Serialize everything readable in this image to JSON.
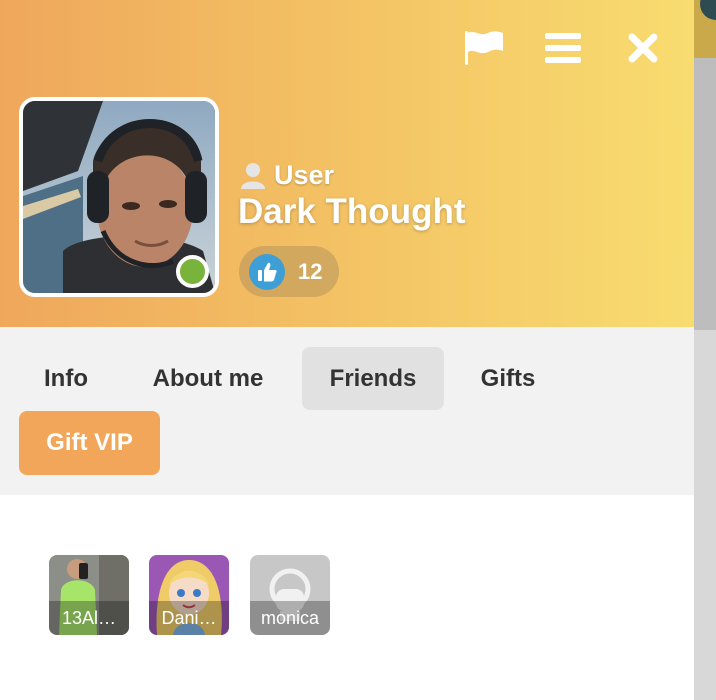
{
  "header": {
    "icons": {
      "flag": "flag-icon",
      "menu": "menu-icon",
      "close": "close-icon"
    },
    "user_type": "User",
    "user_name": "Dark Thought",
    "likes_count": "12",
    "online": true
  },
  "tabs": [
    {
      "label": "Info"
    },
    {
      "label": "About me"
    },
    {
      "label": "Friends",
      "active": true
    },
    {
      "label": "Gifts"
    }
  ],
  "gift_vip_label": "Gift VIP",
  "friends": [
    {
      "name": "13Al…"
    },
    {
      "name": "Dani…"
    },
    {
      "name": "monica"
    }
  ],
  "colors": {
    "header_gradient_start": "#efa75c",
    "header_gradient_end": "#f8dc70",
    "accent_orange": "#f2a65a",
    "online_green": "#78b33b",
    "like_blue": "#3d9fd6",
    "tabbar_bg": "#f2f2f2",
    "active_tab_bg": "#e1e1e1"
  }
}
